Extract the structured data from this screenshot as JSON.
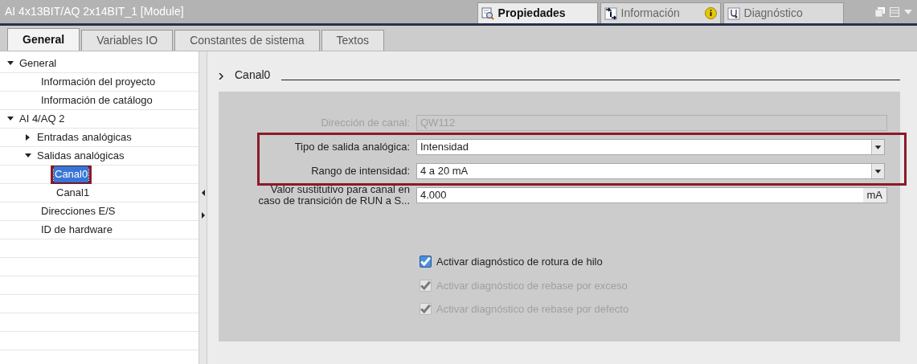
{
  "window": {
    "title": "AI 4x13BIT/AQ 2x14BIT_1 [Module]"
  },
  "inspector_tabs": [
    {
      "label": "Propiedades",
      "selected": true,
      "kind": "properties"
    },
    {
      "label": "Información",
      "selected": false,
      "kind": "info"
    },
    {
      "label": "Diagnóstico",
      "selected": false,
      "kind": "diagnostics"
    }
  ],
  "tabs": [
    {
      "label": "General",
      "selected": true
    },
    {
      "label": "Variables IO",
      "selected": false
    },
    {
      "label": "Constantes de sistema",
      "selected": false
    },
    {
      "label": "Textos",
      "selected": false
    }
  ],
  "tree": [
    {
      "label": "General",
      "expanded": true,
      "children": [
        {
          "label": "Información del proyecto"
        },
        {
          "label": "Información de catálogo"
        }
      ]
    },
    {
      "label": "AI 4/AQ 2",
      "expanded": true,
      "children": [
        {
          "label": "Entradas analógicas",
          "expanded": false
        },
        {
          "label": "Salidas analógicas",
          "expanded": true,
          "children": [
            {
              "label": "Canal0",
              "selected": true,
              "highlighted": true
            },
            {
              "label": "Canal1",
              "selected": false,
              "highlighted": false
            }
          ]
        },
        {
          "label": "Direcciones E/S"
        },
        {
          "label": "ID de hardware"
        }
      ]
    }
  ],
  "section": {
    "title": "Canal0",
    "fields": [
      {
        "kind": "text",
        "label": "Dirección de canal:",
        "value": "QW112",
        "disabled": true,
        "highlighted": false
      },
      {
        "kind": "dropdown",
        "label": "Tipo de salida analógica:",
        "value": "Intensidad",
        "disabled": false,
        "highlighted": true
      },
      {
        "kind": "dropdown",
        "label": "Rango de intensidad:",
        "value": "4 a 20 mA",
        "disabled": false,
        "highlighted": true
      },
      {
        "kind": "unit",
        "label": "Valor sustitutivo para canal en caso de transición de RUN a S...",
        "value": "4.000",
        "unit": "mA",
        "disabled": false,
        "highlighted": false
      }
    ],
    "checkboxes": [
      {
        "label": "Activar diagnóstico de rotura de hilo",
        "checked": true,
        "disabled": false
      },
      {
        "label": "Activar diagnóstico de rebase por exceso",
        "checked": true,
        "disabled": true
      },
      {
        "label": "Activar diagnóstico de rebase por defecto",
        "checked": true,
        "disabled": true
      }
    ]
  }
}
